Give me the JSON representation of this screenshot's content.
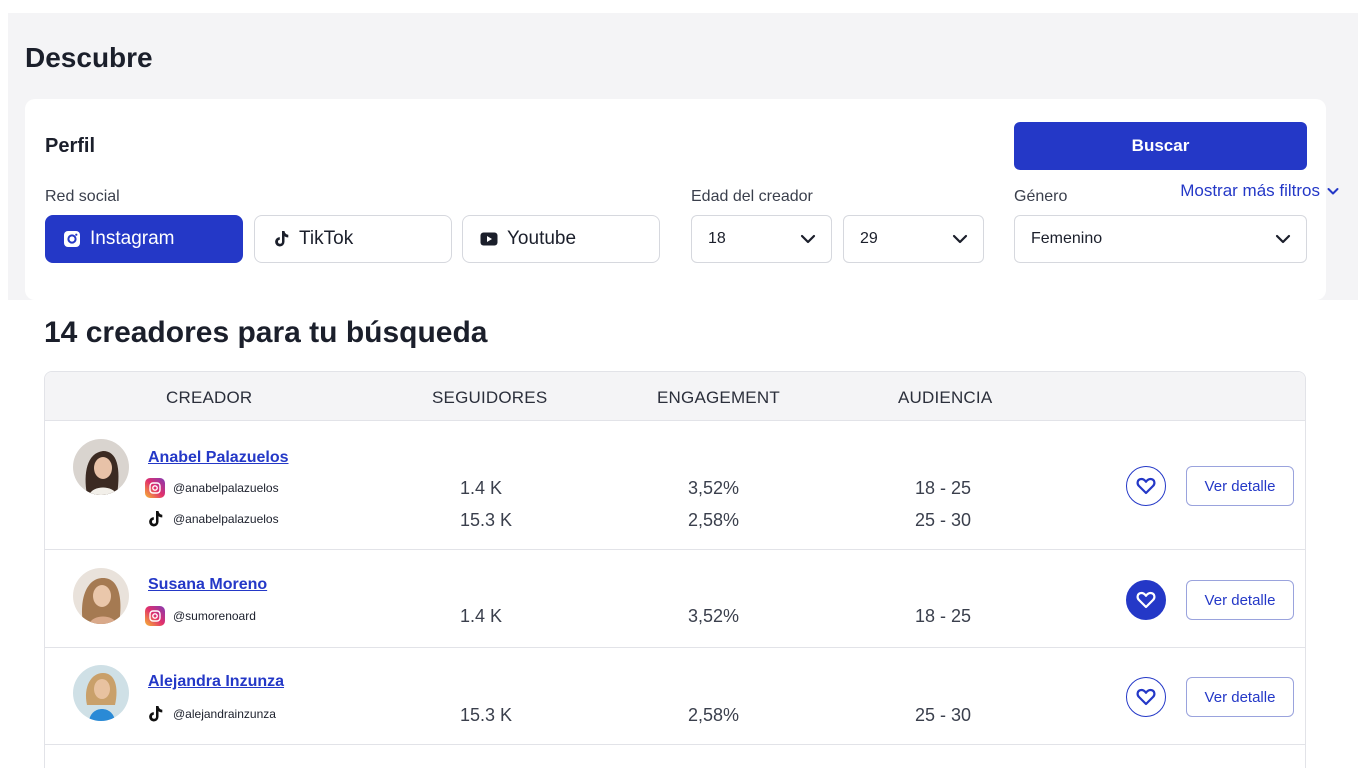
{
  "page": {
    "title": "Descubre"
  },
  "filters": {
    "title": "Perfil",
    "search_label": "Buscar",
    "social_label": "Red social",
    "networks": [
      {
        "label": "Instagram",
        "icon": "instagram-icon",
        "active": true
      },
      {
        "label": "TikTok",
        "icon": "tiktok-icon",
        "active": false
      },
      {
        "label": "Youtube",
        "icon": "youtube-icon",
        "active": false
      }
    ],
    "age_label": "Edad del creador",
    "age_min": "18",
    "age_max": "29",
    "gender_label": "Género",
    "gender_value": "Femenino",
    "more_filters": "Mostrar más filtros"
  },
  "results": {
    "title": "14 creadores para tu búsqueda",
    "headers": {
      "creator": "CREADOR",
      "followers": "SEGUIDORES",
      "engagement": "ENGAGEMENT",
      "audience": "AUDIENCIA"
    },
    "detail_label": "Ver detalle",
    "rows": [
      {
        "name": "Anabel Palazuelos",
        "favorite": false,
        "accounts": [
          {
            "network": "instagram",
            "handle": "@anabelpalazuelos",
            "followers": "1.4 K",
            "engagement": "3,52%",
            "audience": "18 - 25"
          },
          {
            "network": "tiktok",
            "handle": "@anabelpalazuelos",
            "followers": "15.3 K",
            "engagement": "2,58%",
            "audience": "25 - 30"
          }
        ]
      },
      {
        "name": "Susana Moreno",
        "favorite": true,
        "accounts": [
          {
            "network": "instagram",
            "handle": "@sumorenoard",
            "followers": "1.4 K",
            "engagement": "3,52%",
            "audience": "18 - 25"
          }
        ]
      },
      {
        "name": "Alejandra Inzunza",
        "favorite": false,
        "accounts": [
          {
            "network": "tiktok",
            "handle": "@alejandrainzunza",
            "followers": "15.3 K",
            "engagement": "2,58%",
            "audience": "25 - 30"
          }
        ]
      }
    ]
  },
  "colors": {
    "primary": "#2438c7",
    "background": "#f4f4f6",
    "border": "#e2e3e8"
  }
}
